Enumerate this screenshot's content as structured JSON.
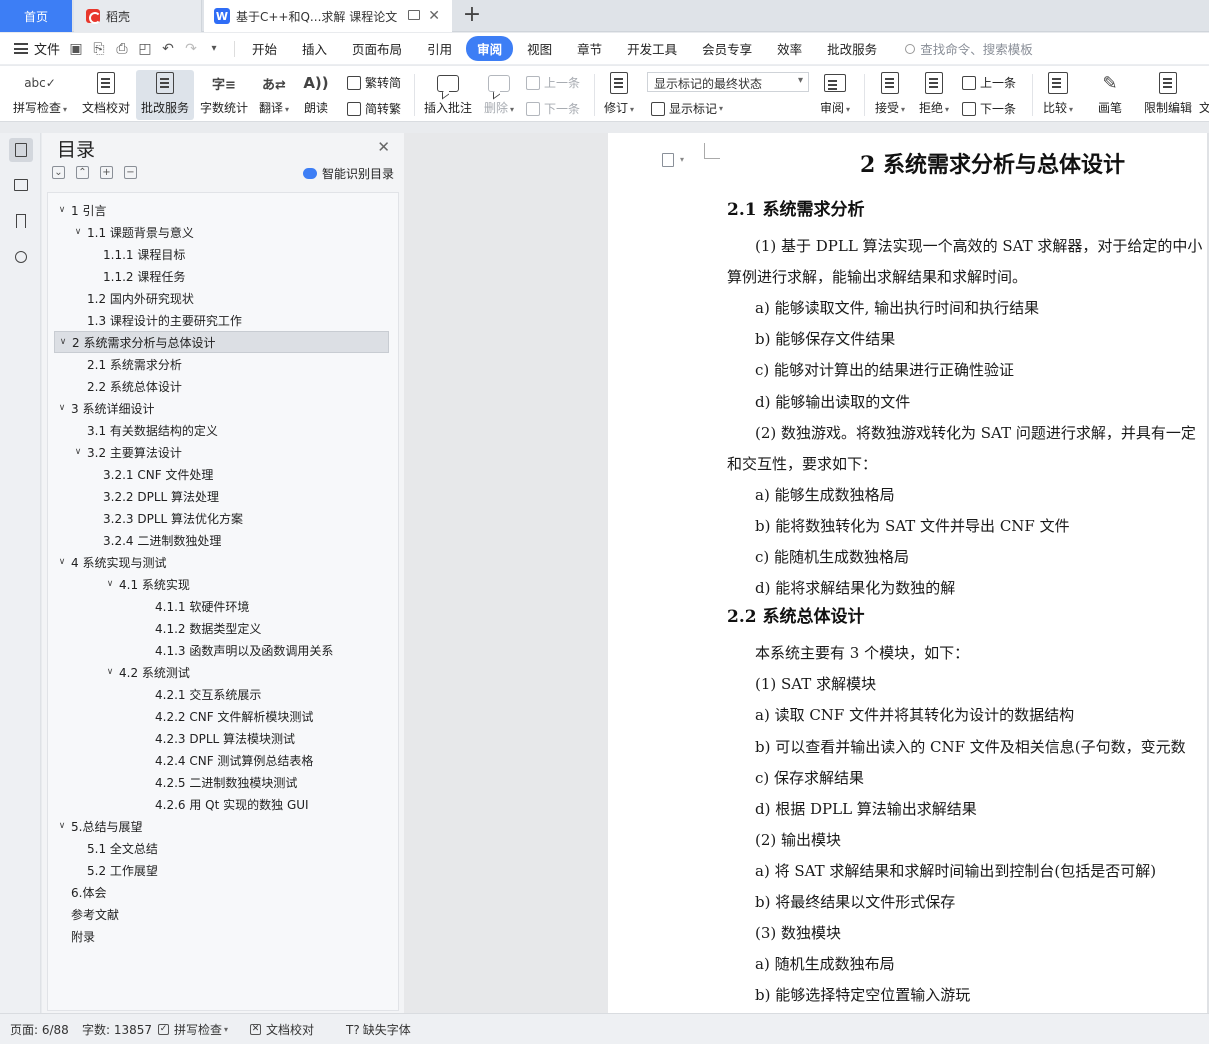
{
  "tabs": {
    "home": "首页",
    "daoke": "稻壳",
    "doc_title": "基于C++和Q...求解 课程论文"
  },
  "menu": {
    "file": "文件",
    "items": [
      "开始",
      "插入",
      "页面布局",
      "引用",
      "审阅",
      "视图",
      "章节",
      "开发工具",
      "会员专享",
      "效率",
      "批改服务"
    ],
    "active": "审阅",
    "search_placeholder": "查找命令、搜索模板"
  },
  "ribbon": {
    "spell_check": "拼写检查",
    "doc_proof": "文档校对",
    "correct_service": "批改服务",
    "word_count": "字数统计",
    "translate": "翻译",
    "read_aloud": "朗读",
    "trad_to_simp": "繁转简",
    "simp_to_trad": "简转繁",
    "insert_comment": "插入批注",
    "delete": "删除",
    "prev": "上一条",
    "next": "下一条",
    "revise": "修订",
    "markup_state": "显示标记的最终状态",
    "show_markup": "显示标记",
    "review": "审阅",
    "accept": "接受",
    "reject": "拒绝",
    "prev2": "上一条",
    "next2": "下一条",
    "compare": "比较",
    "pen": "画笔",
    "restrict_edit": "限制编辑",
    "doc_more": "文"
  },
  "toc": {
    "title": "目录",
    "smart_label": "智能识别目录",
    "items": [
      {
        "text": "1  引言",
        "level": 0,
        "caret": "∨"
      },
      {
        "text": "1.1  课题背景与意义",
        "level": 1,
        "caret": "∨"
      },
      {
        "text": "1.1.1  课程目标",
        "level": 2,
        "caret": ""
      },
      {
        "text": "1.1.2  课程任务",
        "level": 2,
        "caret": ""
      },
      {
        "text": "1.2  国内外研究现状",
        "level": 1,
        "caret": ""
      },
      {
        "text": "1.3  课程设计的主要研究工作",
        "level": 1,
        "caret": ""
      },
      {
        "text": "2  系统需求分析与总体设计",
        "level": 0,
        "caret": "∨"
      },
      {
        "text": "2.1  系统需求分析",
        "level": 1,
        "caret": ""
      },
      {
        "text": "2.2  系统总体设计",
        "level": 1,
        "caret": ""
      },
      {
        "text": "3  系统详细设计",
        "level": 0,
        "caret": "∨"
      },
      {
        "text": "3.1  有关数据结构的定义",
        "level": 1,
        "caret": ""
      },
      {
        "text": "3.2 主要算法设计",
        "level": 1,
        "caret": "∨"
      },
      {
        "text": "3.2.1 CNF 文件处理",
        "level": 2,
        "caret": ""
      },
      {
        "text": "3.2.2 DPLL 算法处理",
        "level": 2,
        "caret": ""
      },
      {
        "text": "3.2.3 DPLL 算法优化方案",
        "level": 2,
        "caret": ""
      },
      {
        "text": "3.2.4  二进制数独处理",
        "level": 2,
        "caret": ""
      },
      {
        "text": "4  系统实现与测试",
        "level": 0,
        "caret": "∨"
      },
      {
        "text": "4.1  系统实现",
        "level": 2,
        "caret": "∨"
      },
      {
        "text": "4.1.1  软硬件环境",
        "level": 3,
        "caret": ""
      },
      {
        "text": "4.1.2  数据类型定义",
        "level": 3,
        "caret": ""
      },
      {
        "text": "4.1.3  函数声明以及函数调用关系",
        "level": 3,
        "caret": ""
      },
      {
        "text": "4.2  系统测试",
        "level": 2,
        "caret": "∨"
      },
      {
        "text": "4.2.1  交互系统展示",
        "level": 3,
        "caret": ""
      },
      {
        "text": "4.2.2 CNF 文件解析模块测试",
        "level": 3,
        "caret": ""
      },
      {
        "text": "4.2.3 DPLL 算法模块测试",
        "level": 3,
        "caret": ""
      },
      {
        "text": "4.2.4 CNF 测试算例总结表格",
        "level": 3,
        "caret": ""
      },
      {
        "text": "4.2.5  二进制数独模块测试",
        "level": 3,
        "caret": ""
      },
      {
        "text": "4.2.6  用 Qt 实现的数独 GUI",
        "level": 3,
        "caret": ""
      },
      {
        "text": "5.总结与展望",
        "level": 0,
        "caret": "∨"
      },
      {
        "text": "5.1  全文总结",
        "level": 1,
        "caret": ""
      },
      {
        "text": "5.2 工作展望",
        "level": 1,
        "caret": ""
      },
      {
        "text": "6.体会",
        "level": 0,
        "caret": ""
      },
      {
        "text": "参考文献",
        "level": 0,
        "caret": ""
      },
      {
        "text": "附录",
        "level": 0,
        "caret": ""
      }
    ],
    "selected_index": 6
  },
  "doc": {
    "h1": "2  系统需求分析与总体设计",
    "lines": [
      {
        "type": "h2",
        "text": "2.1  系统需求分析"
      },
      {
        "type": "p",
        "indent": 1,
        "text": "(1)  基于 DPLL 算法实现一个高效的 SAT 求解器，对于给定的中小"
      },
      {
        "type": "p",
        "indent": 0,
        "text": "算例进行求解，能输出求解结果和求解时间。"
      },
      {
        "type": "p",
        "indent": 1,
        "text": "a)    能够读取文件, 输出执行时间和执行结果"
      },
      {
        "type": "p",
        "indent": 1,
        "text": "b)    能够保存文件结果"
      },
      {
        "type": "p",
        "indent": 1,
        "text": "c)    能够对计算出的结果进行正确性验证"
      },
      {
        "type": "p",
        "indent": 1,
        "text": "d)    能够输出读取的文件"
      },
      {
        "type": "p",
        "indent": 1,
        "text": "(2)  数独游戏。将数独游戏转化为 SAT 问题进行求解，并具有一定"
      },
      {
        "type": "p",
        "indent": 0,
        "text": "和交互性，要求如下："
      },
      {
        "type": "p",
        "indent": 1,
        "text": "a)    能够生成数独格局"
      },
      {
        "type": "p",
        "indent": 1,
        "text": "b)    能将数独转化为 SAT 文件并导出 CNF 文件"
      },
      {
        "type": "p",
        "indent": 1,
        "text": "c)    能随机生成数独格局"
      },
      {
        "type": "p",
        "indent": 1,
        "text": "d)    能将求解结果化为数独的解"
      },
      {
        "type": "h2",
        "text": "2.2  系统总体设计"
      },
      {
        "type": "p",
        "indent": 1,
        "text": "本系统主要有 3 个模块，如下："
      },
      {
        "type": "p",
        "indent": 1,
        "text": "(1)  SAT 求解模块"
      },
      {
        "type": "p",
        "indent": 1,
        "text": "a)    读取 CNF 文件并将其转化为设计的数据结构"
      },
      {
        "type": "p",
        "indent": 1,
        "text": "b)    可以查看并输出读入的 CNF 文件及相关信息(子句数，变元数"
      },
      {
        "type": "p",
        "indent": 1,
        "text": "c)    保存求解结果"
      },
      {
        "type": "p",
        "indent": 1,
        "text": "d)    根据 DPLL 算法输出求解结果"
      },
      {
        "type": "p",
        "indent": 1,
        "text": "(2)  输出模块"
      },
      {
        "type": "p",
        "indent": 1,
        "text": "a)    将 SAT 求解结果和求解时间输出到控制台(包括是否可解)"
      },
      {
        "type": "p",
        "indent": 1,
        "text": "b)    将最终结果以文件形式保存"
      },
      {
        "type": "p",
        "indent": 1,
        "text": "(3)  数独模块"
      },
      {
        "type": "p",
        "indent": 1,
        "text": "a)    随机生成数独布局"
      },
      {
        "type": "p",
        "indent": 1,
        "text": "b)    能够选择特定空位置输入游玩"
      }
    ]
  },
  "status": {
    "page": "页面: 6/88",
    "words": "字数: 13857",
    "spell": "拼写检查",
    "proof": "文档校对",
    "missing_font": "缺失字体"
  },
  "colors": {
    "accent": "#3d7ef5"
  }
}
